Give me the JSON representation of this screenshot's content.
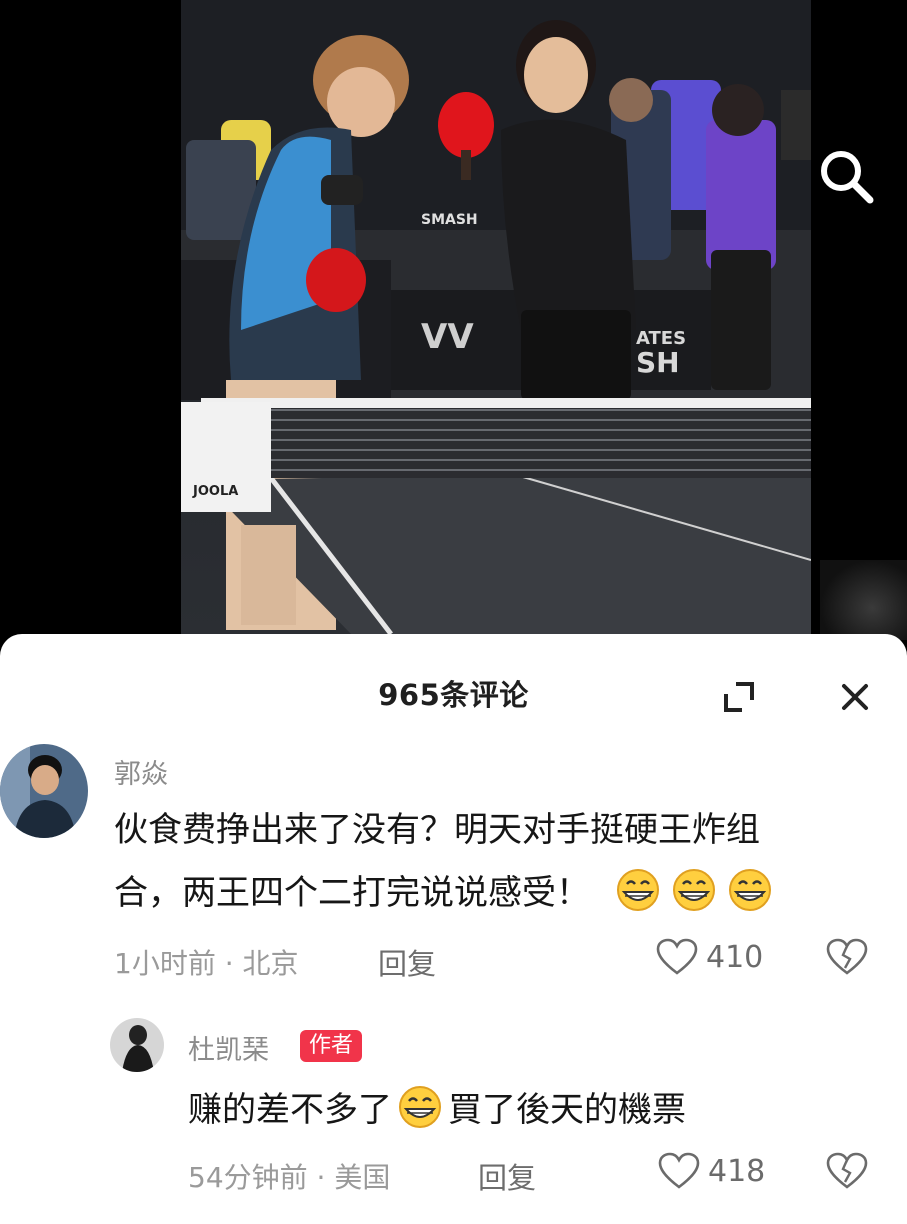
{
  "video": {
    "signs": [
      "SMASH",
      "JOOLA",
      "ATES",
      "SH"
    ],
    "search_icon": "search-icon"
  },
  "comments_panel": {
    "title": "965条评论",
    "expand_icon": "expand-icon",
    "close_icon": "close-icon"
  },
  "comments": [
    {
      "user": "郭焱",
      "line1": "伙食费挣出来了没有？明天对手挺硬王炸组",
      "line2": "合，两王四个二打完说说感受！",
      "emoji": "grin-emoji",
      "time": "1小时前",
      "location": "北京",
      "reply": "回复",
      "likes": "410"
    },
    {
      "user": "杜凯琹",
      "badge": "作者",
      "text_before": "赚的差不多了",
      "text_after": "買了後天的機票",
      "emoji": "grin-emoji",
      "time": "54分钟前",
      "location": "美国",
      "reply": "回复",
      "likes": "418"
    }
  ],
  "colors": {
    "badge": "#f1344a",
    "panel_bg": "#ffffff",
    "video_bg": "#000000"
  }
}
